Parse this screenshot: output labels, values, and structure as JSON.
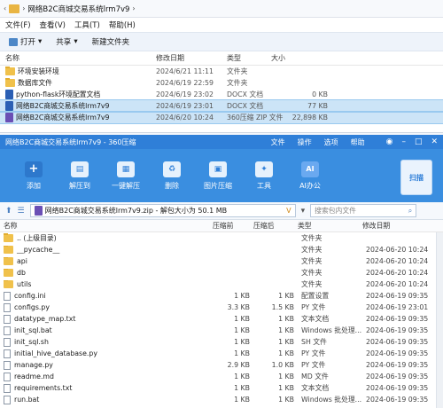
{
  "explorer": {
    "breadcrumb": "网络B2C商城交易系统lrm7v9",
    "menu": [
      "文件(F)",
      "查看(V)",
      "工具(T)",
      "帮助(H)"
    ],
    "toolbar": {
      "open": "打开",
      "share": "共享",
      "new_folder": "新建文件夹"
    },
    "columns": [
      "名称",
      "修改日期",
      "类型",
      "大小"
    ],
    "rows": [
      {
        "name": "环境安装环境",
        "date": "2024/6/21 11:11",
        "type": "文件夹",
        "size": "",
        "icon": "folder-icon"
      },
      {
        "name": "数据库文件",
        "date": "2024/6/19 22:59",
        "type": "文件夹",
        "size": "",
        "icon": "folder-icon"
      },
      {
        "name": "python-flask环境配置文档",
        "date": "2024/6/19 23:02",
        "type": "DOCX 文档",
        "size": "0 KB",
        "icon": "docx-icon"
      },
      {
        "name": "网络B2C商城交易系统lrm7v9",
        "date": "2024/6/19 23:01",
        "type": "DOCX 文档",
        "size": "77 KB",
        "icon": "docx-icon"
      },
      {
        "name": "网络B2C商城交易系统lrm7v9",
        "date": "2024/6/20 10:24",
        "type": "360压缩 ZIP 文件",
        "size": "22,898 KB",
        "icon": "zip-icon"
      }
    ]
  },
  "zip": {
    "title": "网络B2C商城交易系统lrm7v9 - 360压缩",
    "menus": [
      "文件",
      "操作",
      "选项",
      "帮助"
    ],
    "tools": [
      {
        "label": "添加",
        "glyph": "+"
      },
      {
        "label": "解压到",
        "glyph": "▤"
      },
      {
        "label": "一键解压",
        "glyph": "▦"
      },
      {
        "label": "删除",
        "glyph": "♻"
      },
      {
        "label": "图片压缩",
        "glyph": "▣"
      },
      {
        "label": "工具",
        "glyph": "✦"
      },
      {
        "label": "AI办公",
        "glyph": "AI"
      }
    ],
    "scan": "扫描",
    "path": "网络B2C商城交易系统lrm7v9.zip - 解包大小为 50.1 MB",
    "search_placeholder": "搜索包内文件",
    "columns": [
      "名称",
      "压缩前",
      "压缩后",
      "类型",
      "修改日期"
    ],
    "rows": [
      {
        "name": ".. (上级目录)",
        "before": "",
        "after": "",
        "type": "文件夹",
        "date": "",
        "icon": "folder-icon"
      },
      {
        "name": "__pycache__",
        "before": "",
        "after": "",
        "type": "文件夹",
        "date": "2024-06-20 10:24",
        "icon": "folder-icon"
      },
      {
        "name": "api",
        "before": "",
        "after": "",
        "type": "文件夹",
        "date": "2024-06-20 10:24",
        "icon": "folder-icon"
      },
      {
        "name": "db",
        "before": "",
        "after": "",
        "type": "文件夹",
        "date": "2024-06-20 10:24",
        "icon": "folder-icon"
      },
      {
        "name": "utils",
        "before": "",
        "after": "",
        "type": "文件夹",
        "date": "2024-06-20 10:24",
        "icon": "folder-icon"
      },
      {
        "name": "config.ini",
        "before": "1 KB",
        "after": "1 KB",
        "type": "配置设置",
        "date": "2024-06-19 09:35",
        "icon": "file-icon"
      },
      {
        "name": "configs.py",
        "before": "3.3 KB",
        "after": "1.5 KB",
        "type": "PY 文件",
        "date": "2024-06-19 23:01",
        "icon": "file-icon"
      },
      {
        "name": "datatype_map.txt",
        "before": "1 KB",
        "after": "1 KB",
        "type": "文本文档",
        "date": "2024-06-19 09:35",
        "icon": "file-icon"
      },
      {
        "name": "init_sql.bat",
        "before": "1 KB",
        "after": "1 KB",
        "type": "Windows 批处理...",
        "date": "2024-06-19 09:35",
        "icon": "file-icon"
      },
      {
        "name": "init_sql.sh",
        "before": "1 KB",
        "after": "1 KB",
        "type": "SH 文件",
        "date": "2024-06-19 09:35",
        "icon": "file-icon"
      },
      {
        "name": "initial_hive_database.py",
        "before": "1 KB",
        "after": "1 KB",
        "type": "PY 文件",
        "date": "2024-06-19 09:35",
        "icon": "file-icon"
      },
      {
        "name": "manage.py",
        "before": "2.9 KB",
        "after": "1.0 KB",
        "type": "PY 文件",
        "date": "2024-06-19 09:35",
        "icon": "file-icon"
      },
      {
        "name": "readme.md",
        "before": "1 KB",
        "after": "1 KB",
        "type": "MD 文件",
        "date": "2024-06-19 09:35",
        "icon": "file-icon"
      },
      {
        "name": "requirements.txt",
        "before": "1 KB",
        "after": "1 KB",
        "type": "文本文档",
        "date": "2024-06-19 09:35",
        "icon": "file-icon"
      },
      {
        "name": "run.bat",
        "before": "1 KB",
        "after": "1 KB",
        "type": "Windows 批处理...",
        "date": "2024-06-19 09:35",
        "icon": "file-icon"
      }
    ]
  }
}
